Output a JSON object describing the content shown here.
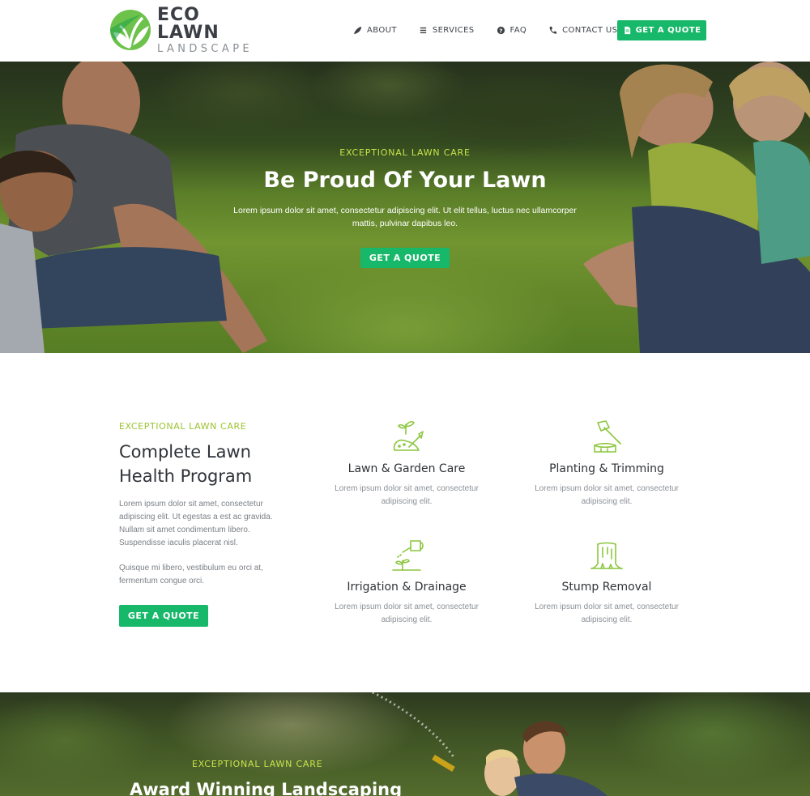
{
  "brand": {
    "name_line1": "ECO LAWN",
    "name_line2": "LANDSCAPE",
    "accent": "#18b86a",
    "lime": "#9cc32e"
  },
  "nav": {
    "items": [
      {
        "label": "ABOUT",
        "icon": "leaf-icon"
      },
      {
        "label": "SERVICES",
        "icon": "list-icon"
      },
      {
        "label": "FAQ",
        "icon": "question-circle-icon"
      },
      {
        "label": "CONTACT US",
        "icon": "phone-icon"
      }
    ],
    "cta": {
      "label": "GET A QUOTE",
      "icon": "document-icon"
    }
  },
  "hero": {
    "eyebrow": "EXCEPTIONAL LAWN CARE",
    "title": "Be Proud Of Your Lawn",
    "text": "Lorem ipsum dolor sit amet, consectetur adipiscing elit. Ut elit tellus, luctus nec ullamcorper mattis, pulvinar dapibus leo.",
    "button": "GET A QUOTE"
  },
  "services": {
    "eyebrow": "EXCEPTIONAL LAWN CARE",
    "title": "Complete Lawn Health Program",
    "paragraph1": "Lorem ipsum dolor sit amet, consectetur adipiscing elit. Ut egestas a est ac gravida. Nullam sit amet condimentum libero. Suspendisse iaculis placerat nisl.",
    "paragraph2": "Quisque mi libero, vestibulum eu orci at, fermentum congue orci.",
    "button": "GET A QUOTE",
    "cards": [
      {
        "title": "Lawn & Garden Care",
        "text": "Lorem ipsum dolor sit amet, consectetur adipiscing elit.",
        "icon": "garden-shovel-icon"
      },
      {
        "title": "Planting & Trimming",
        "text": "Lorem ipsum dolor sit amet, consectetur adipiscing elit.",
        "icon": "axe-stump-icon"
      },
      {
        "title": "Irrigation & Drainage",
        "text": "Lorem ipsum dolor sit amet, consectetur adipiscing elit.",
        "icon": "watering-can-icon"
      },
      {
        "title": "Stump Removal",
        "text": "Lorem ipsum dolor sit amet, consectetur adipiscing elit.",
        "icon": "tree-stump-icon"
      }
    ]
  },
  "banner": {
    "eyebrow": "EXCEPTIONAL LAWN CARE",
    "title": "Award Winning Landscaping"
  }
}
